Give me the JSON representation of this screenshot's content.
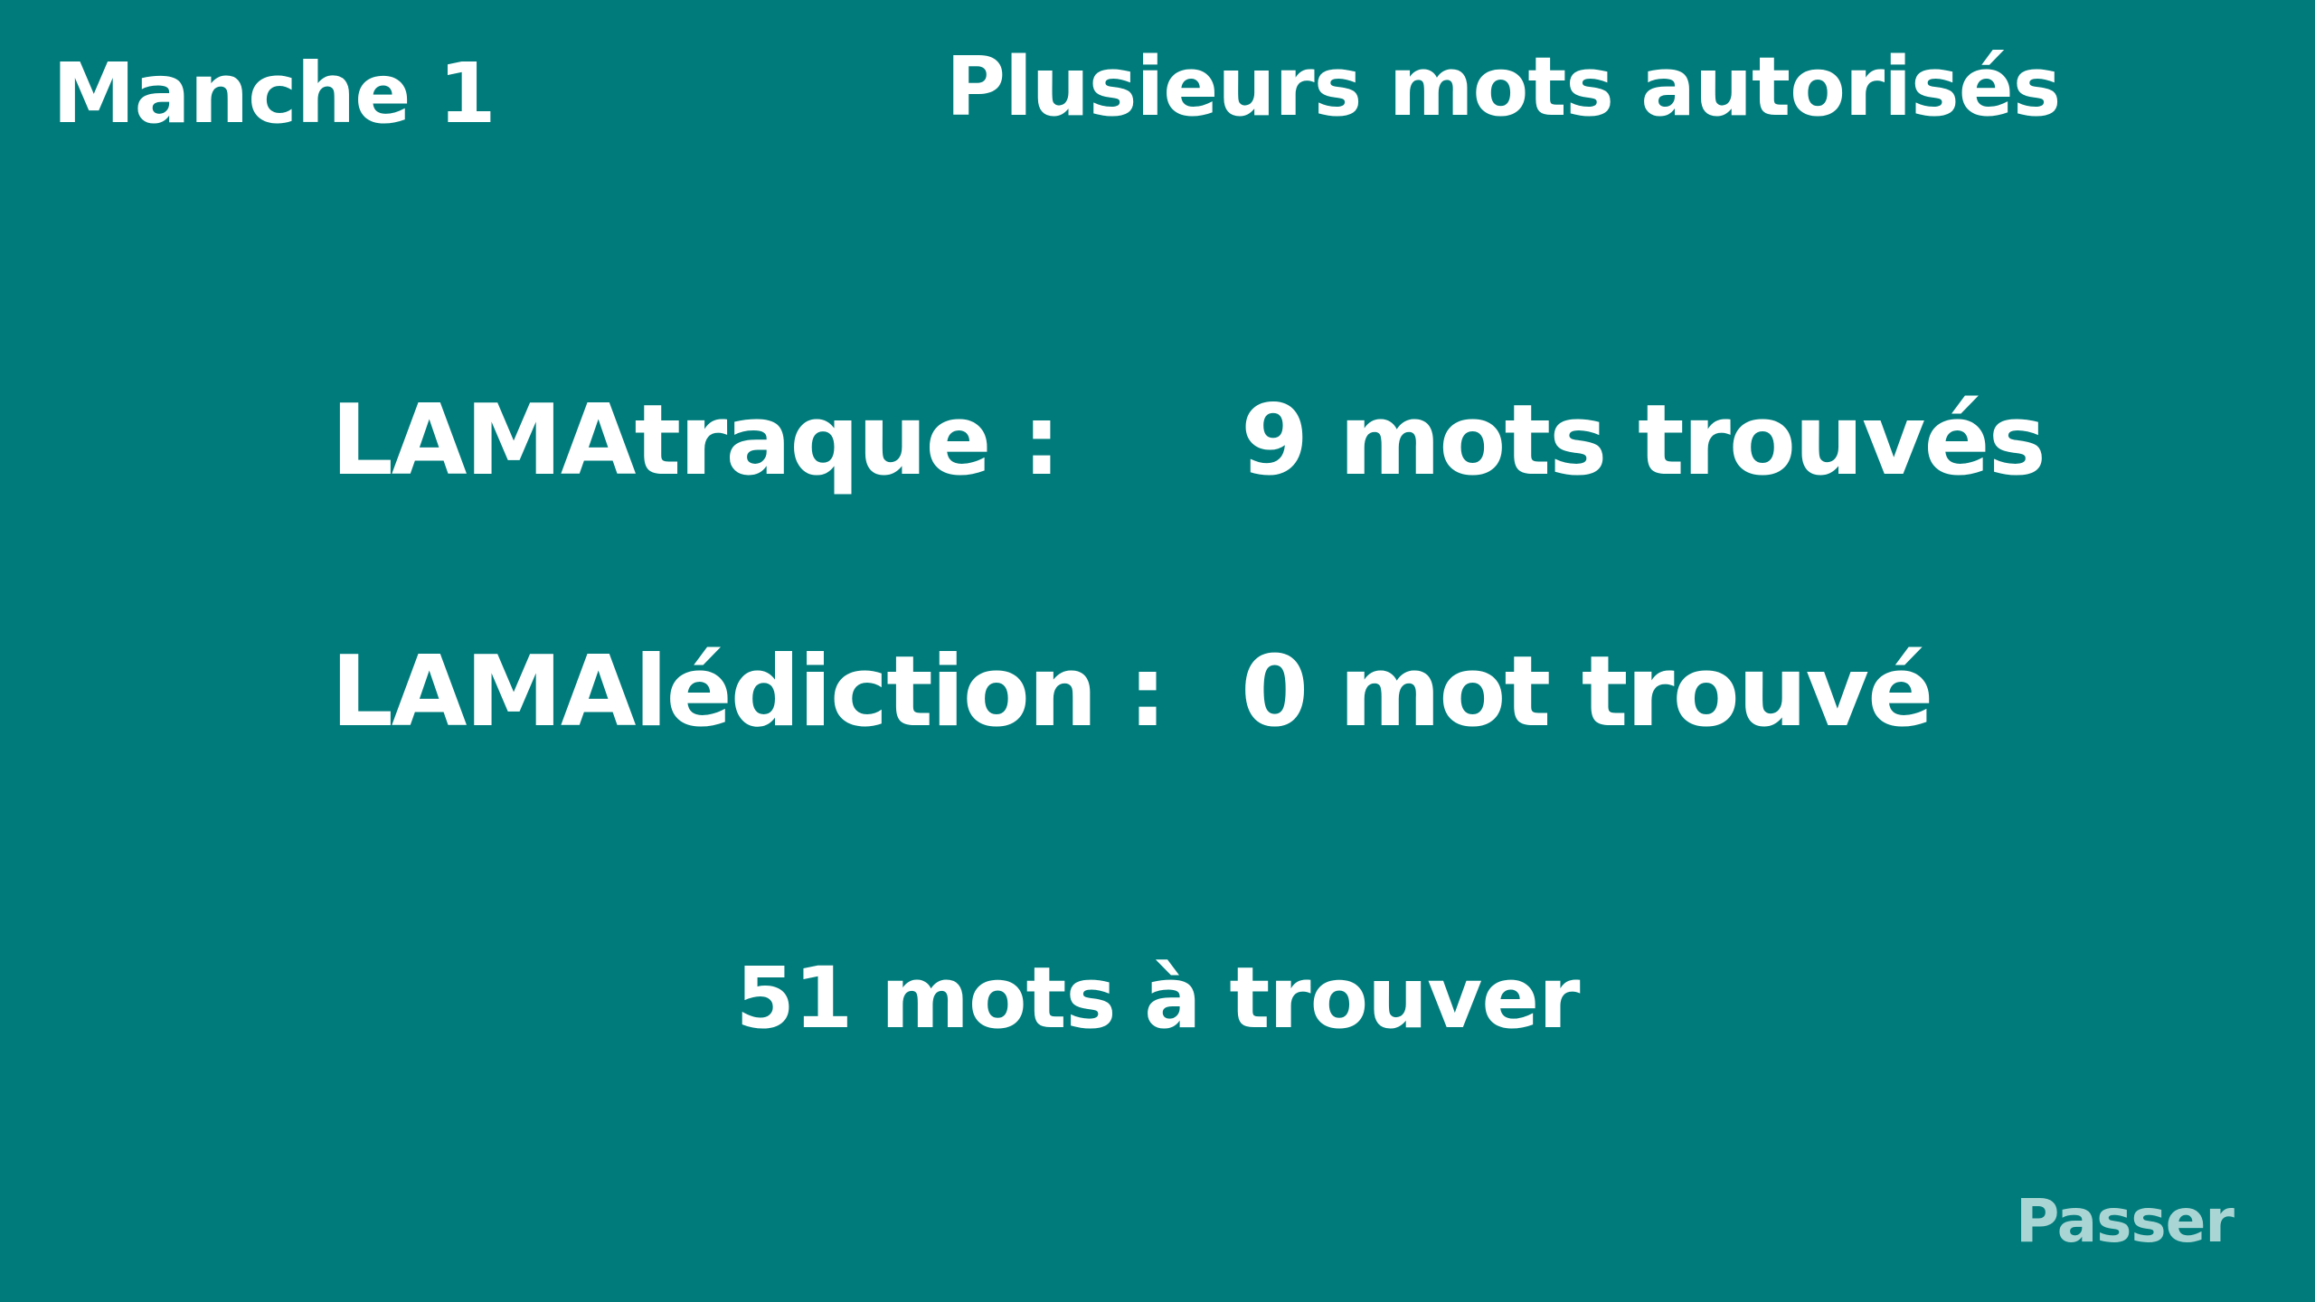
{
  "header": {
    "round": "Manche 1",
    "mode": "Plusieurs mots autorisés"
  },
  "teams": [
    {
      "name": "LAMAtraque :",
      "score": "9 mots trouvés"
    },
    {
      "name": "LAMAlédiction :",
      "score": "0 mot trouvé"
    }
  ],
  "remaining": "51 mots à trouver",
  "actions": {
    "skip_label": "Passer"
  },
  "colors": {
    "background": "#007b7b",
    "text": "#ffffff",
    "skip": "#a9d6d4"
  }
}
